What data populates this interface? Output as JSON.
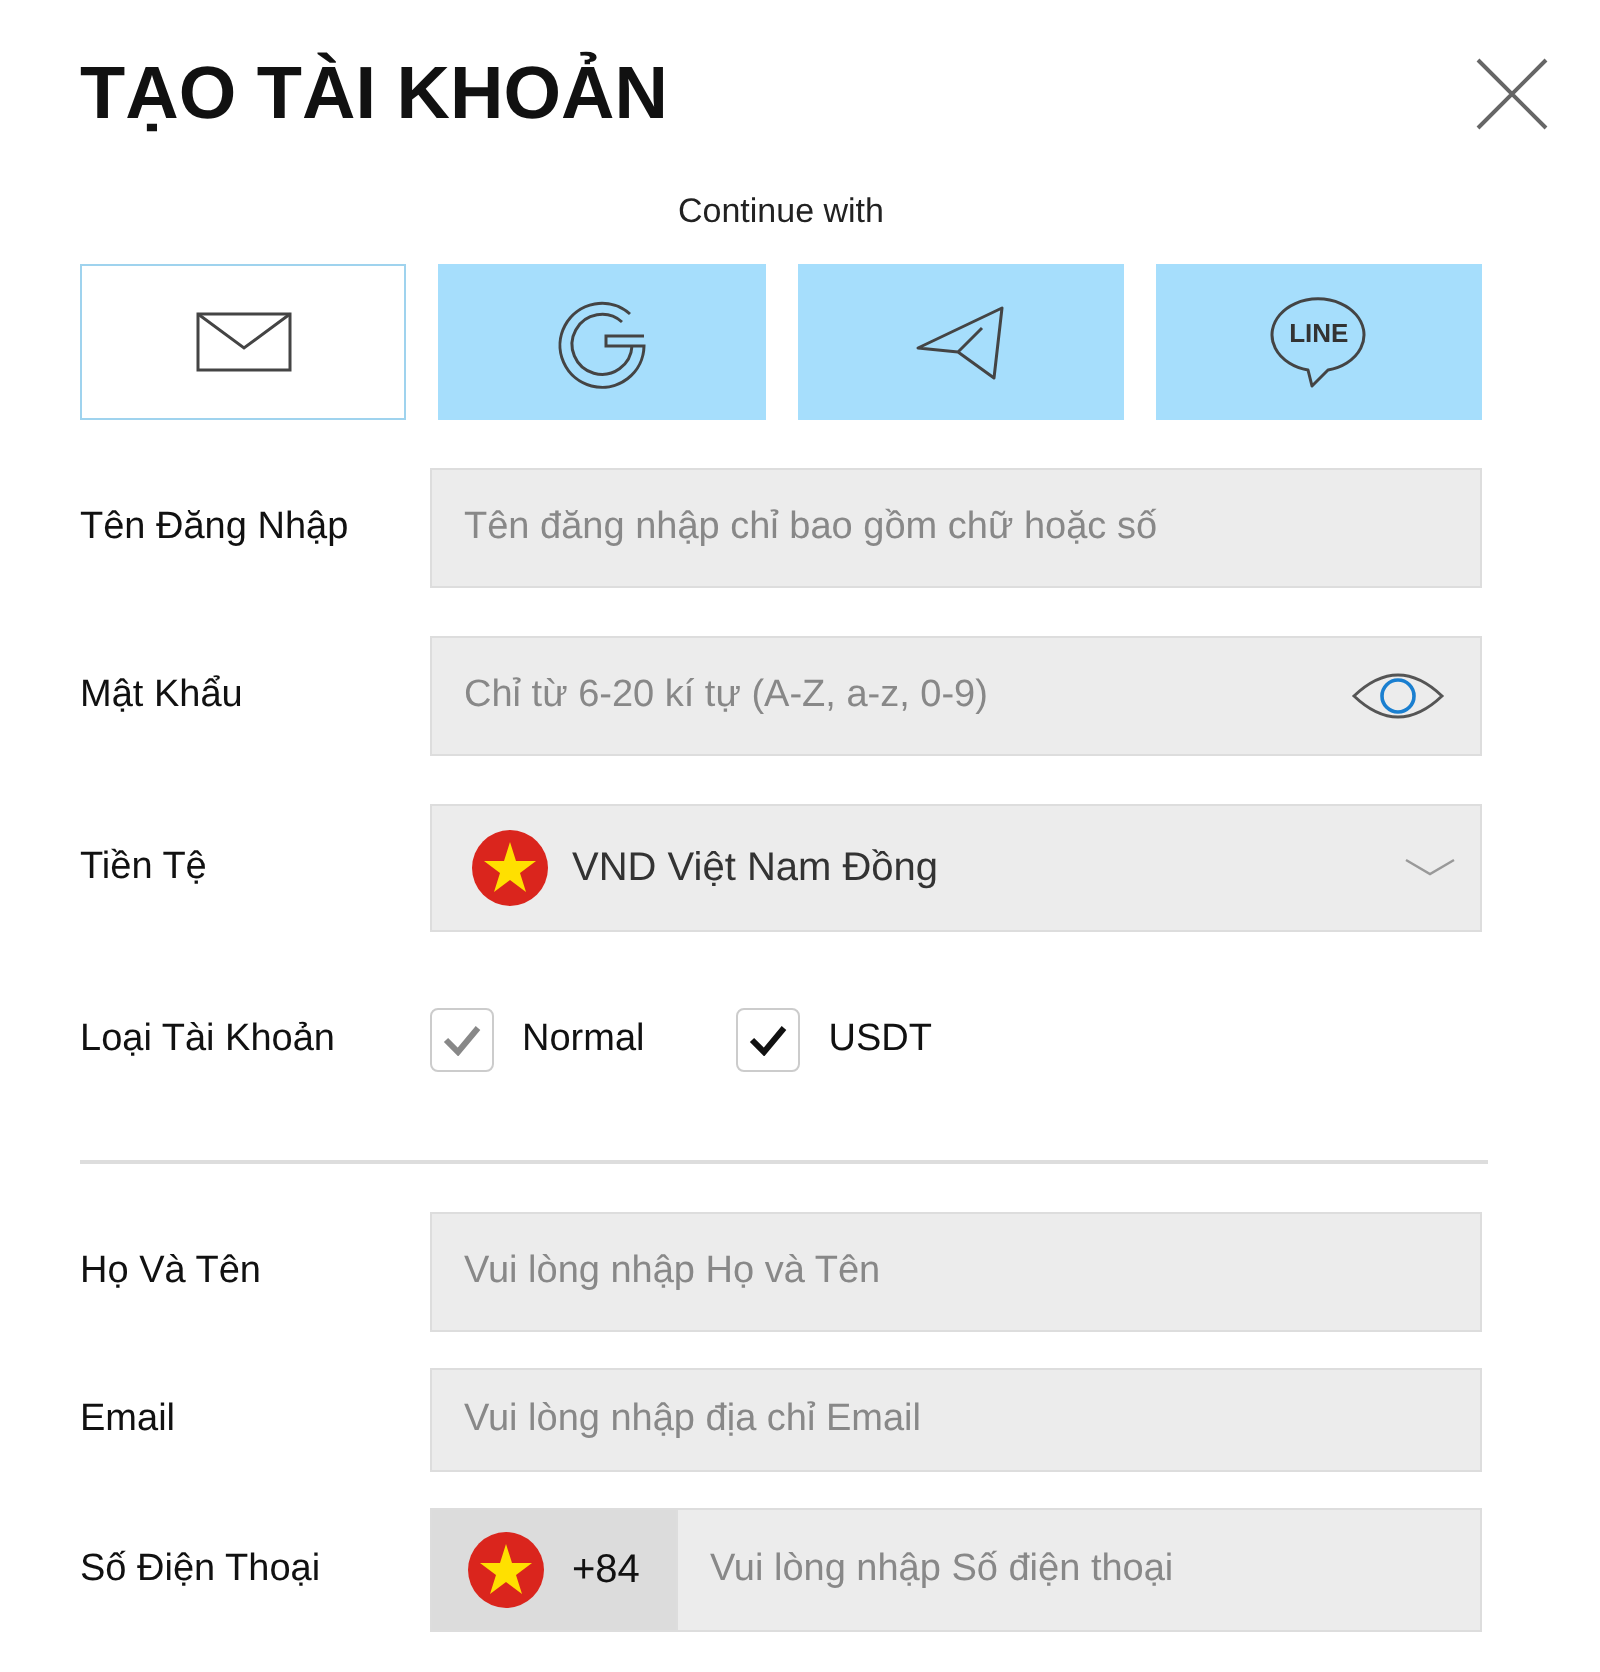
{
  "title": "TẠO TÀI KHOẢN",
  "continue_with": "Continue with",
  "methods": [
    {
      "kind": "email",
      "selected": true
    },
    {
      "kind": "google",
      "selected": false
    },
    {
      "kind": "telegram",
      "selected": false
    },
    {
      "kind": "line",
      "selected": false,
      "text": "LINE"
    }
  ],
  "fields": [
    {
      "kind": "text",
      "label": "Tên Đăng Nhập",
      "placeholder": "Tên đăng nhập chỉ bao gồm chữ hoặc số"
    },
    {
      "kind": "password",
      "label": "Mật Khẩu",
      "placeholder": "Chỉ từ 6-20 kí tự (A-Z, a-z, 0-9)"
    },
    {
      "kind": "select",
      "label": "Tiền Tệ",
      "value": "VND Việt Nam Đồng"
    }
  ],
  "account_type": {
    "label": "Loại Tài Khoản",
    "options": [
      {
        "label": "Normal",
        "checked": true,
        "disabled": true
      },
      {
        "label": "USDT",
        "checked": true,
        "disabled": false
      }
    ]
  },
  "personal_fields": [
    {
      "kind": "text",
      "label": "Họ Và Tên",
      "placeholder": "Vui lòng nhập Họ và Tên"
    },
    {
      "kind": "text",
      "label": "Email",
      "placeholder": "Vui lòng nhập địa chỉ Email"
    },
    {
      "kind": "phone",
      "label": "Số Điện Thoại",
      "code": "+84",
      "placeholder": "Vui lòng nhập Số điện thoại"
    }
  ]
}
